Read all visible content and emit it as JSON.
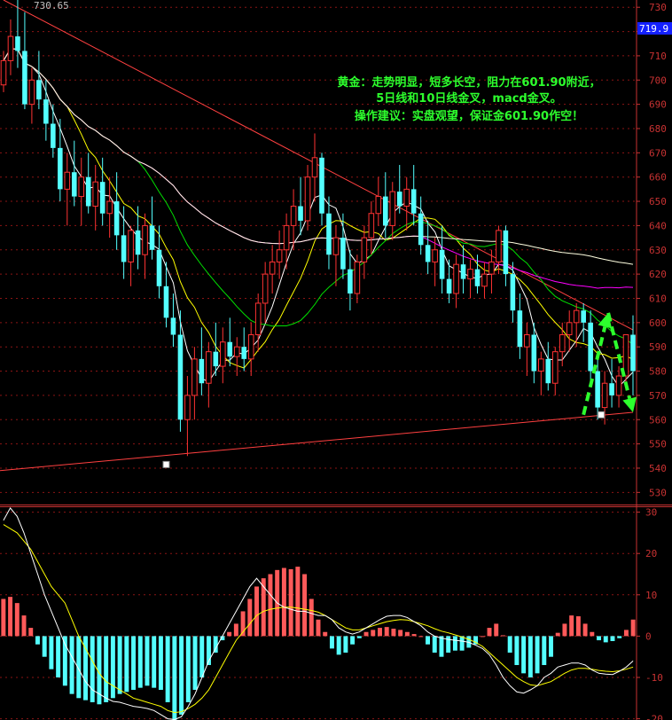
{
  "chart_data": [
    {
      "type": "candlestick",
      "name_label": "",
      "top_price_label": "730.65",
      "current_price_tag": "719.9",
      "ylim": [
        525,
        733
      ],
      "y_ticks": [
        530,
        540,
        550,
        560,
        570,
        580,
        590,
        600,
        610,
        620,
        630,
        640,
        650,
        660,
        670,
        680,
        690,
        700,
        710,
        720,
        730
      ],
      "grid": true,
      "colors": {
        "up": "#ff3232",
        "down": "#54ffff",
        "ma5": "#ffffff",
        "ma10": "#ffff00",
        "ma20": "#00e000",
        "ma60": "#ff00ff",
        "ma200": "#ffffe0",
        "trendline": "#ff4040",
        "annotation": "#2dff2d",
        "arrow": "#2dff2d",
        "axis": "#c83232"
      },
      "annotation_lines": [
        "黄金：走势明显，短多长空，阻力在601.90附近，",
        "5日线和10日线金叉，macd金叉。",
        "操作建议：实盘观望，保证金601.90作空！"
      ],
      "ohlc": [
        [
          698,
          712,
          695,
          708
        ],
        [
          708,
          725,
          702,
          718
        ],
        [
          718,
          733,
          705,
          712
        ],
        [
          712,
          728,
          688,
          690
        ],
        [
          690,
          705,
          682,
          700
        ],
        [
          700,
          712,
          688,
          692
        ],
        [
          692,
          700,
          675,
          682
        ],
        [
          682,
          690,
          668,
          672
        ],
        [
          672,
          684,
          650,
          655
        ],
        [
          655,
          670,
          640,
          662
        ],
        [
          662,
          675,
          648,
          652
        ],
        [
          652,
          668,
          640,
          660
        ],
        [
          660,
          670,
          645,
          648
        ],
        [
          648,
          665,
          638,
          658
        ],
        [
          658,
          668,
          640,
          645
        ],
        [
          645,
          660,
          635,
          650
        ],
        [
          650,
          662,
          630,
          636
        ],
        [
          636,
          648,
          618,
          625
        ],
        [
          625,
          640,
          615,
          638
        ],
        [
          638,
          648,
          622,
          628
        ],
        [
          628,
          645,
          618,
          640
        ],
        [
          640,
          652,
          626,
          630
        ],
        [
          630,
          640,
          610,
          615
        ],
        [
          615,
          625,
          598,
          602
        ],
        [
          602,
          612,
          590,
          595
        ],
        [
          595,
          605,
          555,
          560
        ],
        [
          560,
          578,
          545,
          570
        ],
        [
          570,
          590,
          560,
          585
        ],
        [
          585,
          598,
          570,
          575
        ],
        [
          575,
          592,
          565,
          588
        ],
        [
          588,
          600,
          578,
          582
        ],
        [
          582,
          598,
          575,
          592
        ],
        [
          592,
          602,
          582,
          586
        ],
        [
          586,
          594,
          578,
          590
        ],
        [
          590,
          598,
          580,
          585
        ],
        [
          585,
          600,
          578,
          595
        ],
        [
          595,
          612,
          588,
          608
        ],
        [
          608,
          625,
          600,
          620
        ],
        [
          620,
          632,
          612,
          625
        ],
        [
          625,
          638,
          618,
          630
        ],
        [
          630,
          645,
          622,
          640
        ],
        [
          640,
          655,
          630,
          648
        ],
        [
          648,
          660,
          636,
          642
        ],
        [
          642,
          665,
          638,
          660
        ],
        [
          660,
          678,
          650,
          668
        ],
        [
          668,
          670,
          640,
          645
        ],
        [
          645,
          652,
          622,
          628
        ],
        [
          628,
          640,
          615,
          635
        ],
        [
          635,
          645,
          618,
          622
        ],
        [
          622,
          630,
          605,
          612
        ],
        [
          612,
          628,
          608,
          625
        ],
        [
          625,
          640,
          618,
          635
        ],
        [
          635,
          650,
          628,
          645
        ],
        [
          645,
          660,
          640,
          652
        ],
        [
          652,
          662,
          635,
          640
        ],
        [
          640,
          658,
          634,
          654
        ],
        [
          654,
          665,
          645,
          648
        ],
        [
          648,
          660,
          638,
          655
        ],
        [
          655,
          665,
          640,
          645
        ],
        [
          645,
          652,
          628,
          632
        ],
        [
          632,
          642,
          620,
          625
        ],
        [
          625,
          635,
          615,
          630
        ],
        [
          630,
          640,
          612,
          618
        ],
        [
          618,
          626,
          608,
          612
        ],
        [
          612,
          628,
          606,
          624
        ],
        [
          624,
          632,
          612,
          618
        ],
        [
          618,
          626,
          610,
          622
        ],
        [
          622,
          628,
          612,
          615
        ],
        [
          615,
          625,
          610,
          620
        ],
        [
          620,
          630,
          612,
          625
        ],
        [
          625,
          640,
          620,
          638
        ],
        [
          638,
          640,
          615,
          620
        ],
        [
          620,
          625,
          600,
          605
        ],
        [
          605,
          612,
          585,
          590
        ],
        [
          590,
          600,
          578,
          595
        ],
        [
          595,
          600,
          575,
          580
        ],
        [
          580,
          588,
          570,
          585
        ],
        [
          585,
          592,
          572,
          575
        ],
        [
          575,
          590,
          570,
          588
        ],
        [
          588,
          600,
          582,
          595
        ],
        [
          595,
          605,
          588,
          600
        ],
        [
          600,
          608,
          590,
          605
        ],
        [
          605,
          608,
          592,
          600
        ],
        [
          600,
          605,
          575,
          580
        ],
        [
          580,
          585,
          560,
          565
        ],
        [
          565,
          580,
          558,
          575
        ],
        [
          575,
          585,
          565,
          570
        ],
        [
          570,
          582,
          565,
          578
        ],
        [
          578,
          590,
          572,
          595
        ],
        [
          595,
          603,
          570,
          580
        ]
      ],
      "ma_periods": [
        5,
        10,
        20,
        60,
        200
      ],
      "trendlines": [
        {
          "name": "upper-resistance",
          "points": [
            [
              0,
              733
            ],
            [
              89,
              597
            ]
          ]
        },
        {
          "name": "lower-support",
          "points": [
            [
              -6,
              537.5
            ],
            [
              89,
              563
            ]
          ]
        }
      ],
      "arrows": [
        {
          "name": "up-arrow",
          "from": [
            82,
            562
          ],
          "to": [
            85.5,
            604
          ]
        },
        {
          "name": "down-arrow",
          "from": [
            85.5,
            604
          ],
          "to": [
            89,
            563
          ]
        }
      ],
      "markers": [
        {
          "name": "low-marker",
          "x": 23,
          "y": 541.5
        },
        {
          "name": "recent-low-marker",
          "x": 84.5,
          "y": 562
        }
      ]
    },
    {
      "type": "macd",
      "ylim": [
        -20.3,
        31.2
      ],
      "y_ticks": [
        30,
        20,
        10,
        0,
        -10,
        -20
      ],
      "colors": {
        "pos": "#ff5a5a",
        "neg": "#54ffff",
        "dif": "#ffffff",
        "dea": "#ffff00"
      },
      "hist": [
        9,
        9.5,
        8,
        5,
        2,
        -2,
        -5,
        -8,
        -10,
        -12,
        -14,
        -15,
        -15.5,
        -16,
        -16.5,
        -16,
        -15,
        -14,
        -13.5,
        -13,
        -12.5,
        -12,
        -12.5,
        -13,
        -16,
        -21,
        -19,
        -16,
        -13,
        -10,
        -7,
        -4,
        -1,
        1,
        3,
        6,
        9,
        12,
        14,
        15,
        16,
        16.5,
        16.2,
        16.8,
        15,
        9,
        4,
        1,
        -3,
        -4.5,
        -4,
        -2,
        -0.5,
        1,
        1.5,
        2,
        2.2,
        1.8,
        1.5,
        1,
        0.5,
        0,
        -2,
        -4,
        -5,
        -4,
        -3.5,
        -3.5,
        -2.8,
        -2,
        0,
        2,
        3,
        0.2,
        -4,
        -7,
        -9,
        -10,
        -9,
        -7,
        -5,
        0.8,
        3,
        5,
        4.8,
        3,
        1,
        -1,
        -1.5,
        -1.2,
        -0.5,
        1.5,
        4
      ],
      "dif": [
        28,
        31,
        29,
        25,
        20,
        15,
        10,
        6,
        2,
        -2,
        -5,
        -8,
        -11,
        -13,
        -14,
        -15,
        -15.8,
        -16,
        -16.5,
        -17,
        -17.2,
        -17.5,
        -18,
        -19,
        -20,
        -20.2,
        -19.5,
        -17,
        -14,
        -10,
        -6,
        -3,
        0,
        3,
        6,
        9,
        12,
        14,
        12,
        10,
        8,
        7,
        6.5,
        6,
        6,
        5.5,
        5,
        5,
        4,
        2,
        1,
        0.5,
        1,
        2,
        3,
        4,
        4.8,
        5,
        5,
        4.5,
        3.5,
        2.5,
        1,
        0,
        -0.5,
        -0.8,
        -1,
        -1.2,
        -1.5,
        -2.2,
        -3,
        -4.5,
        -7,
        -10,
        -12,
        -13.5,
        -13.8,
        -13,
        -12,
        -10,
        -9,
        -7.5,
        -7,
        -6.5,
        -6.5,
        -7,
        -8.2,
        -9,
        -9.2,
        -9.3,
        -8.5,
        -7.5,
        -6
      ],
      "dea": [
        27,
        26,
        25,
        23,
        21,
        18,
        15,
        12,
        10,
        8,
        4,
        0,
        -3,
        -6,
        -9,
        -11,
        -12,
        -13,
        -14,
        -15,
        -15.5,
        -16,
        -16.5,
        -17,
        -18,
        -18.5,
        -18.3,
        -17.5,
        -16.5,
        -15,
        -13,
        -10,
        -7,
        -4,
        -1,
        1,
        3,
        5,
        6,
        6.5,
        6.8,
        7,
        7,
        6.8,
        6.5,
        6.2,
        5.8,
        5,
        4,
        3,
        2,
        1.5,
        1.5,
        2,
        2.5,
        3,
        3.5,
        3.8,
        4,
        3.9,
        3.5,
        3,
        2.5,
        1.8,
        1.2,
        0.8,
        0.3,
        -0.2,
        -0.8,
        -1.5,
        -2.5,
        -4,
        -5.5,
        -7,
        -8.5,
        -10,
        -11,
        -11.8,
        -12,
        -11.5,
        -11,
        -10,
        -9,
        -8.2,
        -7.8,
        -7.8,
        -8,
        -8.3,
        -8.5,
        -8.6,
        -8.4,
        -8,
        -7.5
      ]
    }
  ]
}
